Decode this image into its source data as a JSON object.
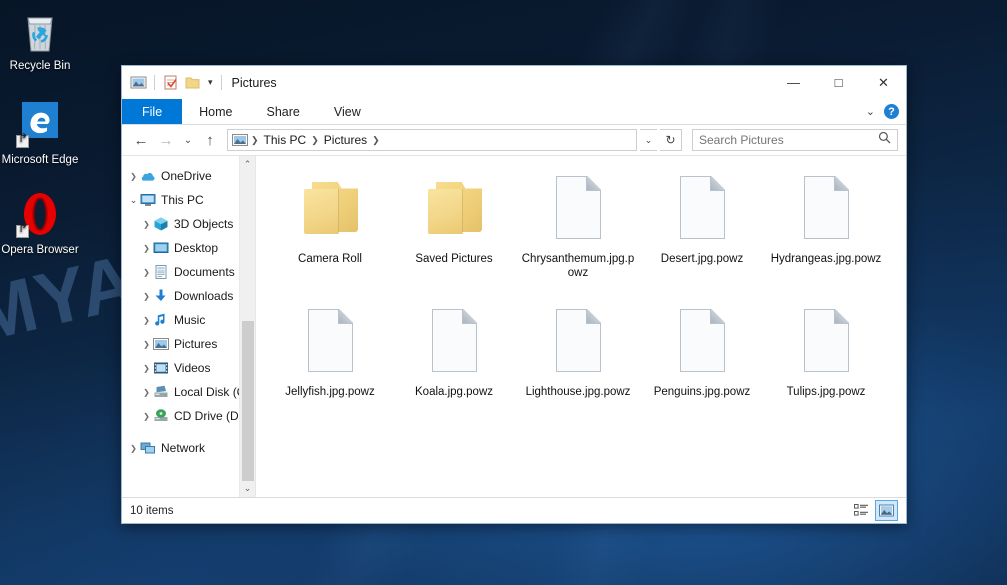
{
  "desktop": {
    "watermark": "MYANTISPYWARE.COM",
    "icons": [
      {
        "label": "Recycle Bin",
        "icon": "recycle-bin-icon"
      },
      {
        "label": "Microsoft Edge",
        "icon": "edge-icon"
      },
      {
        "label": "Opera Browser",
        "icon": "opera-icon"
      }
    ]
  },
  "window": {
    "title": "Pictures",
    "quick_access": [
      {
        "name": "pictures-library-icon"
      },
      {
        "name": "properties-icon"
      },
      {
        "name": "new-folder-icon"
      }
    ],
    "qat_dropdown": "▾",
    "controls": {
      "minimize": "—",
      "maximize": "□",
      "close": "✕"
    },
    "ribbon": {
      "tabs": [
        {
          "label": "File",
          "active": true
        },
        {
          "label": "Home",
          "active": false
        },
        {
          "label": "Share",
          "active": false
        },
        {
          "label": "View",
          "active": false
        }
      ],
      "collapse_chevron": "⌄",
      "help_label": "?"
    },
    "address": {
      "back": "←",
      "forward": "→",
      "recent": "⌄",
      "up": "↑",
      "crumbs": [
        "This PC",
        "Pictures"
      ],
      "crumb_sep": "❯",
      "dropdown": "⌄",
      "refresh": "↻"
    },
    "search": {
      "placeholder": "Search Pictures",
      "value": "",
      "icon": "search-icon"
    },
    "nav_pane": {
      "items": [
        {
          "label": "OneDrive",
          "level": 1,
          "expanded": false,
          "icon": "onedrive-icon"
        },
        {
          "label": "This PC",
          "level": 1,
          "expanded": true,
          "icon": "thispc-icon"
        },
        {
          "label": "3D Objects",
          "level": 2,
          "expanded": false,
          "icon": "3dobjects-icon"
        },
        {
          "label": "Desktop",
          "level": 2,
          "expanded": false,
          "icon": "desktop-icon"
        },
        {
          "label": "Documents",
          "level": 2,
          "expanded": false,
          "icon": "documents-icon"
        },
        {
          "label": "Downloads",
          "level": 2,
          "expanded": false,
          "icon": "downloads-icon"
        },
        {
          "label": "Music",
          "level": 2,
          "expanded": false,
          "icon": "music-icon"
        },
        {
          "label": "Pictures",
          "level": 2,
          "expanded": false,
          "icon": "pictures-icon"
        },
        {
          "label": "Videos",
          "level": 2,
          "expanded": false,
          "icon": "videos-icon"
        },
        {
          "label": "Local Disk (C:)",
          "level": 2,
          "expanded": false,
          "icon": "harddisk-icon"
        },
        {
          "label": "CD Drive (D:) CC",
          "level": 2,
          "expanded": false,
          "icon": "cddrive-icon"
        },
        {
          "label": "Network",
          "level": 1,
          "expanded": false,
          "icon": "network-icon"
        }
      ],
      "scrollbar": {
        "up": "⌃",
        "down": "⌄"
      }
    },
    "files": [
      {
        "name": "Camera Roll",
        "type": "folder"
      },
      {
        "name": "Saved Pictures",
        "type": "folder"
      },
      {
        "name": "Chrysanthemum.jpg.powz",
        "type": "file"
      },
      {
        "name": "Desert.jpg.powz",
        "type": "file"
      },
      {
        "name": "Hydrangeas.jpg.powz",
        "type": "file"
      },
      {
        "name": "Jellyfish.jpg.powz",
        "type": "file"
      },
      {
        "name": "Koala.jpg.powz",
        "type": "file"
      },
      {
        "name": "Lighthouse.jpg.powz",
        "type": "file"
      },
      {
        "name": "Penguins.jpg.powz",
        "type": "file"
      },
      {
        "name": "Tulips.jpg.powz",
        "type": "file"
      }
    ],
    "status": {
      "item_count": "10 items",
      "view_details": "details-view-icon",
      "view_large_icons": "large-icons-view-icon"
    }
  },
  "colors": {
    "accent": "#0078d7",
    "folder": "#f2d588",
    "selection": "#cde8ff"
  }
}
